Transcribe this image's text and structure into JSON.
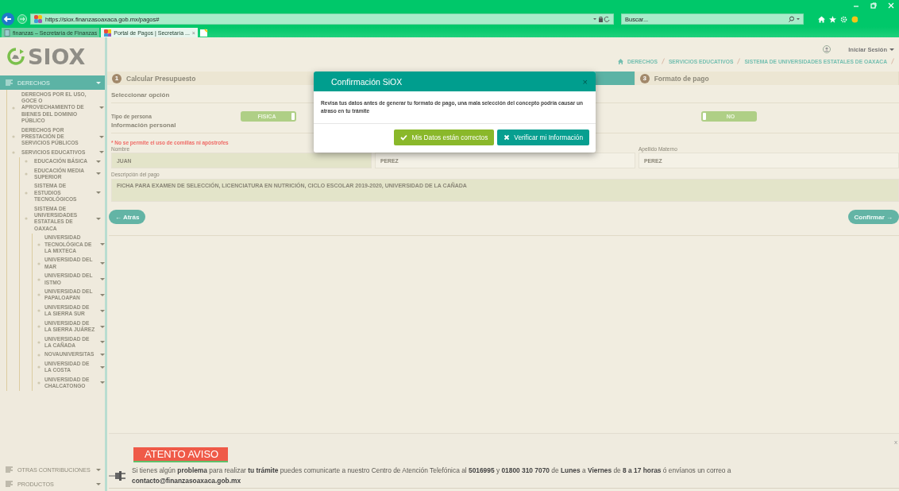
{
  "browser": {
    "url": "https://siox.finanzasoaxaca.gob.mx/pagos#",
    "search_placeholder": "Buscar...",
    "tabs": [
      {
        "label": "finanzas – Secretaría de Finanzas",
        "selected": false
      },
      {
        "label": "Portal de Pagos | Secretaría ...",
        "close": "×",
        "selected": true
      }
    ]
  },
  "header": {
    "logo": "SIOX",
    "login": "Iniciar Sesión",
    "breadcrumbs": [
      "DERECHOS",
      "SERVICIOS EDUCATIVOS",
      "SISTEMA DE UNIVERSIDADES ESTATALES DE OAXACA"
    ]
  },
  "sidebar": {
    "sections": [
      {
        "label": "DERECHOS",
        "selected": true,
        "children": [
          {
            "label": "DERECHOS POR EL USO, GOCE O APROVECHAMIENTO DE BIENES DEL DOMINIO PÚBLICO"
          },
          {
            "label": "DERECHOS POR PRESTACIÓN DE SERVICIOS PÚBLICOS"
          },
          {
            "label": "SERVICIOS EDUCATIVOS",
            "children": [
              {
                "label": "EDUCACIÓN BÁSICA"
              },
              {
                "label": "EDUCACIÓN MEDIA SUPERIOR"
              },
              {
                "label": "SISTEMA DE ESTUDIOS TECNOLÓGICOS"
              },
              {
                "label": "SISTEMA DE UNIVERSIDADES ESTATALES DE OAXACA",
                "children": [
                  {
                    "label": "UNIVERSIDAD TECNOLÓGICA DE LA MIXTECA"
                  },
                  {
                    "label": "UNIVERSIDAD DEL MAR"
                  },
                  {
                    "label": "UNIVERSIDAD DEL ISTMO"
                  },
                  {
                    "label": "UNIVERSIDAD DEL PAPALOAPAN"
                  },
                  {
                    "label": "UNIVERSIDAD DE LA SIERRA SUR"
                  },
                  {
                    "label": "UNIVERSIDAD DE LA SIERRA JUÁREZ"
                  },
                  {
                    "label": "UNIVERSIDAD DE LA CAÑADA"
                  },
                  {
                    "label": "NOVAUNIVERSITAS"
                  },
                  {
                    "label": "UNIVERSIDAD DE LA COSTA"
                  },
                  {
                    "label": "UNIVERSIDAD DE CHALCATONGO"
                  }
                ]
              }
            ]
          }
        ]
      },
      {
        "label": "OTRAS CONTRIBUCIONES",
        "selected": false
      },
      {
        "label": "PRODUCTOS",
        "selected": false
      }
    ]
  },
  "steps": [
    {
      "number": "1",
      "label": "Calcular Presupuesto",
      "selected": false
    },
    {
      "selected": true
    },
    {
      "number": "3",
      "label": "Formato de pago",
      "selected": false
    }
  ],
  "form": {
    "section_title": "Seleccionar opción",
    "person_type_label": "Tipo de persona",
    "toggles": [
      {
        "label": "FISICA",
        "on": true
      },
      {
        "label": "NO",
        "on": false
      }
    ],
    "personal_title": "Información personal",
    "warning": "* No se permite el uso de comillas ni apóstrofes",
    "fields": [
      {
        "label": "Nombre",
        "value": "JUAN",
        "highlighted": true
      },
      {
        "value": "PEREZ",
        "highlighted": false
      },
      {
        "label": "Apellido Materno",
        "value": "PEREZ",
        "highlighted": false
      }
    ],
    "description_label": "Descripción del pago",
    "description": "FICHA PARA EXAMEN DE SELECCIÓN, LICENCIATURA EN NUTRICIÓN, CICLO ESCOLAR 2019-2020, UNIVERSIDAD DE LA CAÑADA",
    "back": "← Atrás",
    "confirm": "Confirmar →"
  },
  "modal": {
    "title": "Confirmación SiOX",
    "close": "×",
    "message": "Revisa tus datos antes de generar tu formato de pago, una mala selección del concepto podría causar un atraso en tu trámite",
    "buttons": [
      {
        "kind": "confirm",
        "label": "Mis Datos están correctos"
      },
      {
        "kind": "verify",
        "label": "Verificar mi Información"
      }
    ]
  },
  "notice": {
    "title": "ATENTO AVISO",
    "close": "x",
    "text": "Si tienes algún **problema** para realizar **tu trámite** puedes comunicarte a nuestro Centro de Atención Telefónica al **5016995** y **01800 310 7070** de **Lunes** a **Viernes** de **8 a 17 horas** ó envíanos un correo a **contacto@finanzasoaxaca.gob.mx**"
  }
}
